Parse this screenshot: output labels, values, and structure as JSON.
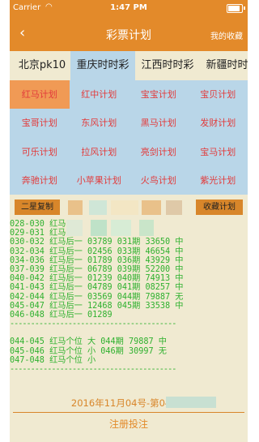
{
  "status": {
    "carrier": "Carrier",
    "time": "1:47 PM"
  },
  "nav": {
    "back": "‹",
    "title": "彩票计划",
    "favorites": "我的收藏"
  },
  "tabs": [
    "北京pk10",
    "重庆时时彩",
    "江西时时彩",
    "新疆时时彩"
  ],
  "plans": [
    "红马计划",
    "红中计划",
    "宝宝计划",
    "宝贝计划",
    "宝哥计划",
    "东风计划",
    "黑马计划",
    "发财计划",
    "可乐计划",
    "拉风计划",
    "亮剑计划",
    "宝马计划",
    "奔驰计划",
    "小苹果计划",
    "火鸟计划",
    "紫光计划"
  ],
  "tools": {
    "copy": "二星复制",
    "save": "收藏计划"
  },
  "results": [
    "028-030 红马",
    "029-031 红马",
    "030-032 红马后一  03789 031期 33650 中",
    "032-034 红马后一  02456 033期 46654 中",
    "034-036 红马后一  01789 036期 43929 中",
    "037-039 红马后一  06789 039期 52200 中",
    "040-042 红马后一  01239 040期 74913 中",
    "041-043 红马后一  04789 041期 08257 中",
    "042-044 红马后一  03569 044期 79887 无",
    "045-047 红马后一  12468 045期 33538 中",
    "046-048 红马后一  01289",
    "----------------------------------------",
    "",
    "044-045 红马个位 大  044期 79887 中",
    "045-046 红马个位 小  046期 30997 无",
    "047-048 红马个位 小",
    "----------------------------------------"
  ],
  "bottom": {
    "date": "2016年11月04号-第046期",
    "register": "注册投注"
  }
}
